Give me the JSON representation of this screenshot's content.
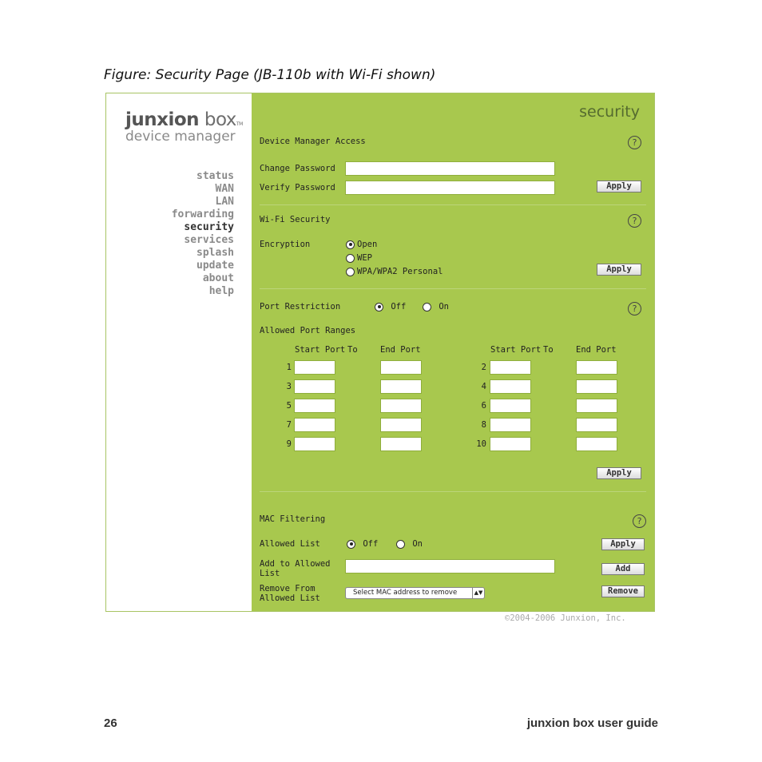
{
  "caption": "Figure: Security Page (JB-110b with Wi-Fi shown)",
  "logo": {
    "brand_bold": "junxion",
    "brand": "box",
    "tm": "TM",
    "subtitle": "device manager"
  },
  "nav": [
    "status",
    "WAN",
    "LAN",
    "forwarding",
    "security",
    "services",
    "splash",
    "update",
    "about",
    "help"
  ],
  "nav_active": "security",
  "page_title": "security",
  "help_glyph": "?",
  "device_manager": {
    "heading": "Device Manager Access",
    "change_password_label": "Change Password",
    "verify_password_label": "Verify Password",
    "change_password_value": "",
    "verify_password_value": "",
    "apply": "Apply"
  },
  "wifi": {
    "heading": "Wi-Fi Security",
    "encryption_label": "Encryption",
    "options": [
      "Open",
      "WEP",
      "WPA/WPA2 Personal"
    ],
    "selected": "Open",
    "apply": "Apply"
  },
  "ports": {
    "restriction_label": "Port Restriction",
    "off": "Off",
    "on": "On",
    "selected": "Off",
    "ranges_label": "Allowed Port Ranges",
    "col_start": "Start Port",
    "col_to": "To",
    "col_end": "End Port",
    "left_rows": [
      "1",
      "3",
      "5",
      "7",
      "9"
    ],
    "right_rows": [
      "2",
      "4",
      "6",
      "8",
      "10"
    ],
    "apply": "Apply"
  },
  "mac": {
    "heading": "MAC Filtering",
    "allowed_list_label": "Allowed List",
    "off": "Off",
    "on": "On",
    "selected": "Off",
    "add_label_1": "Add to Allowed",
    "add_label_2": "List",
    "add_value": "",
    "remove_label_1": "Remove From",
    "remove_label_2": "Allowed List",
    "select_value": "Select MAC address to remove",
    "select_arrows": "▲▼",
    "apply": "Apply",
    "add": "Add",
    "remove": "Remove"
  },
  "copyright": "©2004-2006 Junxion, Inc.",
  "footer": {
    "page_number": "26",
    "guide_title": "junxion box user guide"
  },
  "colors": {
    "panel": "#a8c84e",
    "accent": "#556b2f"
  }
}
